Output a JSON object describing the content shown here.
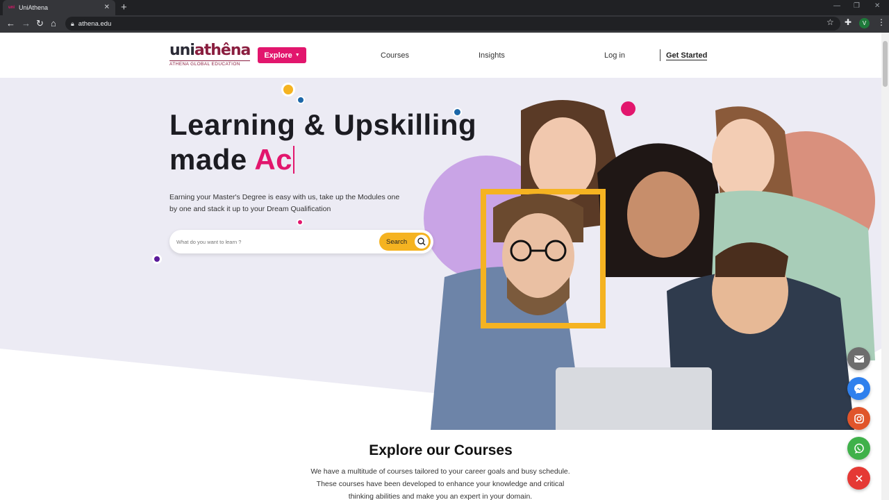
{
  "browser": {
    "tab_title": "UniAthena",
    "tab_favicon": "uni",
    "url": "athena.edu",
    "profile_initial": "V"
  },
  "header": {
    "logo_uni": "uni",
    "logo_athena": "athêna",
    "logo_tagline": "ATHENA GLOBAL EDUCATION",
    "explore_label": "Explore",
    "nav": [
      "Courses",
      "Insights"
    ],
    "login_label": "Log in",
    "get_started_label": "Get Started"
  },
  "hero": {
    "headline_line1": "Learning & Upskilling",
    "headline_line2_prefix": "made ",
    "headline_line2_accent": "Ac",
    "subtext": "Earning your Master's Degree is easy with us, take up the Modules one by one and stack it up to your Dream Qualification",
    "search_placeholder": "What do you want to learn ?",
    "search_button": "Search"
  },
  "courses_section": {
    "title": "Explore our Courses",
    "text": "We have a multitude of courses tailored to your career goals and busy schedule. These courses have been developed to enhance your knowledge and critical thinking abilities and make you an expert in your domain."
  },
  "floating_actions": [
    {
      "icon": "mail-icon",
      "color": "#6d6d6d"
    },
    {
      "icon": "messenger-icon",
      "color": "#2f80ed"
    },
    {
      "icon": "instagram-icon",
      "color": "#e0552b"
    },
    {
      "icon": "whatsapp-icon",
      "color": "#3fb14a"
    },
    {
      "icon": "close-icon",
      "color": "#e53935"
    }
  ],
  "colors": {
    "brand_pink": "#e2166d",
    "brand_yellow": "#f5b321",
    "hero_bg": "#ecebf4"
  }
}
